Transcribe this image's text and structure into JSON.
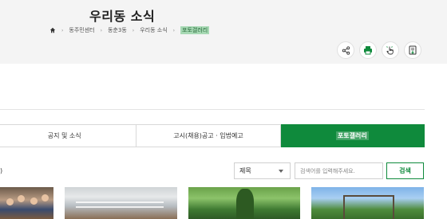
{
  "header": {
    "title": "우리동 소식",
    "breadcrumb": [
      "동주민센터",
      "동춘3동",
      "우리동 소식",
      "포토갤러리"
    ]
  },
  "tools": [
    {
      "icon": "share-icon"
    },
    {
      "icon": "print-icon"
    },
    {
      "icon": "hand-pointer-icon"
    },
    {
      "icon": "download-icon"
    }
  ],
  "tabs": [
    {
      "label": "공지 및 소식",
      "active": false
    },
    {
      "label": "고시(채용)공고 · 입법예고",
      "active": false
    },
    {
      "label": "포토갤러리",
      "active": true
    }
  ],
  "list": {
    "count_text": ")"
  },
  "search": {
    "select_value": "제목",
    "placeholder": "검색어를 입력해주세요.",
    "button_label": "검색"
  },
  "colors": {
    "accent": "#0f8a3c",
    "header_bg": "#f4f4f4"
  }
}
